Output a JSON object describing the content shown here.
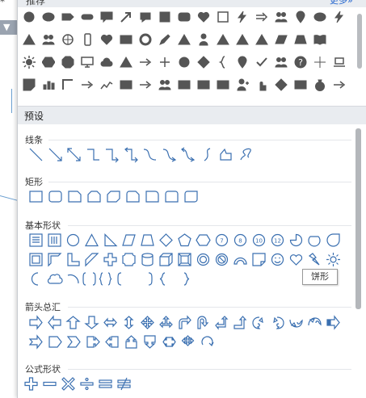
{
  "panel": {
    "recommended_title": "推荐",
    "more_label": "更多»",
    "preset_title": "预设",
    "categories": [
      {
        "label": "线条"
      },
      {
        "label": "矩形"
      },
      {
        "label": "基本形状"
      },
      {
        "label": "箭头总汇"
      },
      {
        "label": "公式形状"
      }
    ],
    "tooltip": "饼形"
  },
  "background": {
    "star_glyph": "*"
  },
  "colors": {
    "shape_stroke": "#3a6fb0",
    "rec_fill": "#555555",
    "accent_link": "#2a6ad0",
    "header_bg": "#e9ecf0"
  }
}
